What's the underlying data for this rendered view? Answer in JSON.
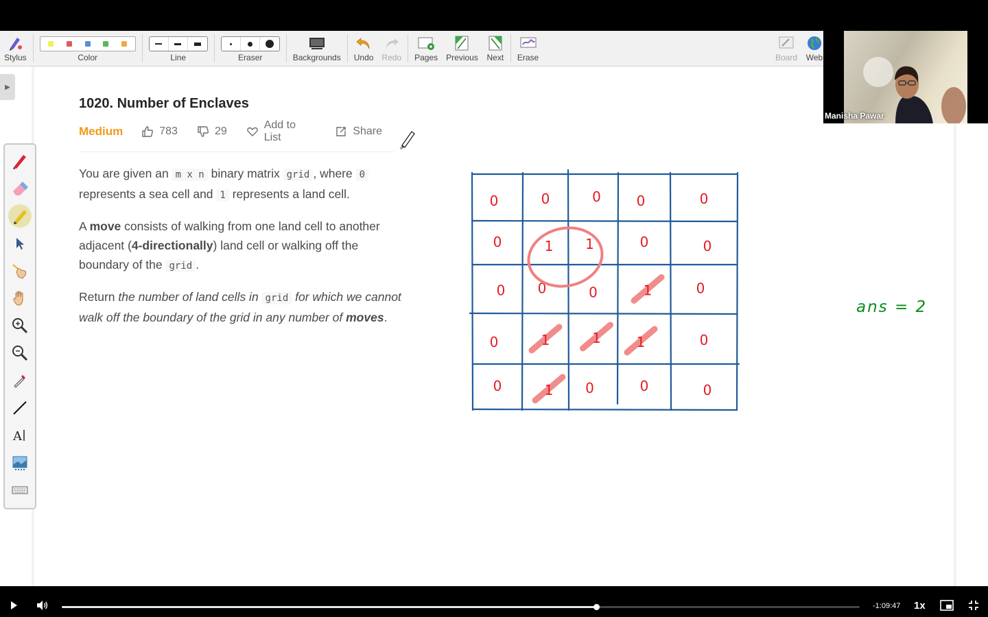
{
  "toolbar": {
    "stylus_label": "Stylus",
    "color_label": "Color",
    "line_label": "Line",
    "eraser_label": "Eraser",
    "backgrounds_label": "Backgrounds",
    "undo_label": "Undo",
    "redo_label": "Redo",
    "pages_label": "Pages",
    "previous_label": "Previous",
    "next_label": "Next",
    "erase_label": "Erase",
    "board_label": "Board",
    "web_label": "Web",
    "colors": [
      "#f0f05a",
      "#e05a5a",
      "#5a8fd8",
      "#5ab85a",
      "#f0a84a"
    ]
  },
  "problem": {
    "title": "1020. Number of Enclaves",
    "difficulty": "Medium",
    "likes": "783",
    "dislikes": "29",
    "add_to_list": "Add to List",
    "share": "Share",
    "p1": {
      "t1": "You are given an ",
      "c1": "m x n",
      "t2": " binary matrix ",
      "c2": "grid",
      "t3": ", where ",
      "c3": "0",
      "t4": " represents a sea cell and ",
      "c4": "1",
      "t5": " represents a land cell."
    },
    "p2": {
      "t1": "A ",
      "b1": "move",
      "t2": " consists of walking from one land cell to another adjacent (",
      "b2": "4-directionally",
      "t3": ") land cell or walking off the boundary of the ",
      "c1": "grid",
      "t4": "."
    },
    "p3": {
      "t1": "Return ",
      "i1": "the number of land cells in ",
      "c1": "grid",
      "i2": " for which we cannot walk off the boundary of the grid in any number of ",
      "b1": "moves",
      "t2": "."
    }
  },
  "drawing": {
    "grid_cells": [
      [
        "0",
        "0",
        "0",
        "0",
        "0"
      ],
      [
        "0",
        "1",
        "1",
        "0",
        "0"
      ],
      [
        "0",
        "0",
        "0",
        "1",
        "0"
      ],
      [
        "0",
        "1",
        "1",
        "1",
        "0"
      ],
      [
        "0",
        "1",
        "0",
        "0",
        "0"
      ]
    ],
    "answer_text": "ans = 2",
    "ink_red": "#e31b23",
    "ink_blue": "#1f5a99",
    "ink_green": "#0a8a1a",
    "highlight": "#f08080"
  },
  "webcam": {
    "participant_name": "Manisha Pawar"
  },
  "player": {
    "time_remaining": "-1:09:47",
    "speed": "1x",
    "progress_fraction": 0.67
  }
}
